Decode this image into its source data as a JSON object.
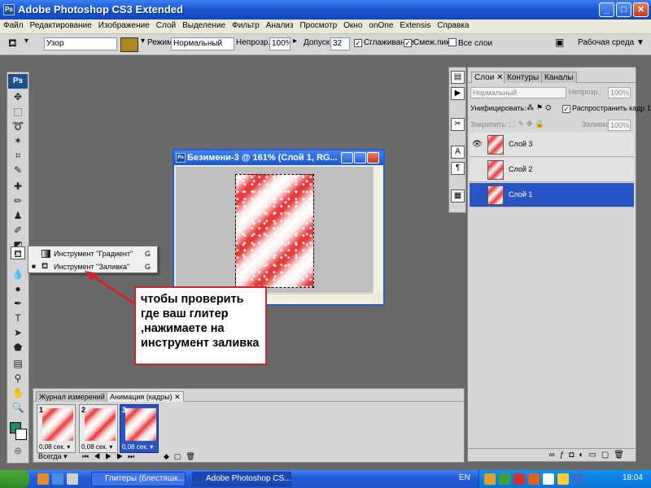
{
  "window": {
    "title": "Adobe Photoshop CS3 Extended",
    "logo": "Ps"
  },
  "menu": [
    "Файл",
    "Редактирование",
    "Изображение",
    "Слой",
    "Выделение",
    "Фильтр",
    "Анализ",
    "Просмотр",
    "Окно",
    "onOne",
    "Extensis",
    "Справка"
  ],
  "options": {
    "pattern_value": "Узор",
    "mode_label": "Режим:",
    "mode_value": "Нормальный",
    "opacity_label": "Непрозр.:",
    "opacity_value": "100%",
    "tolerance_label": "Допуск:",
    "tolerance_value": "32",
    "antialias_label": "Сглаживание",
    "contiguous_label": "Смеж.пикс",
    "all_layers_label": "Все слои",
    "workspace_label": "Рабочая среда"
  },
  "toolbox": {
    "logo": "Ps"
  },
  "flyout": {
    "items": [
      {
        "label": "Инструмент \"Градиент\"",
        "key": "G",
        "active": false
      },
      {
        "label": "Инструмент \"Заливка\"",
        "key": "G",
        "active": true
      }
    ]
  },
  "document": {
    "title": "Безимени-3 @ 161% (Слой 1, RG..."
  },
  "callout": {
    "text": "чтобы проверить где ваш глитер ,нажимаете на инструмент заливка"
  },
  "layers_panel": {
    "tabs": [
      "Слои",
      "Контуры",
      "Каналы"
    ],
    "blend_mode": "Нормальный",
    "opacity_label": "Непрозр.:",
    "opacity_value": "100%",
    "unify_label": "Унифицировать:",
    "propagate_label": "Распространить кадр 1",
    "lock_label": "Закрепить:",
    "fill_label": "Заливка:",
    "fill_value": "100%",
    "layers": [
      {
        "name": "Слой 3",
        "visible": true,
        "selected": false
      },
      {
        "name": "Слой 2",
        "visible": false,
        "selected": false
      },
      {
        "name": "Слой 1",
        "visible": false,
        "selected": true
      }
    ]
  },
  "animation_panel": {
    "tabs": [
      "Журнал измерений",
      "Анимация (кадры)"
    ],
    "frames": [
      {
        "number": "1",
        "delay": "0,08 сек.",
        "selected": false
      },
      {
        "number": "2",
        "delay": "0,08 сек.",
        "selected": false
      },
      {
        "number": "3",
        "delay": "0,08 сек.",
        "selected": true
      }
    ],
    "loop": "Всегда"
  },
  "taskbar": {
    "tasks": [
      {
        "label": "Глитеры (блестяшк...",
        "active": false
      },
      {
        "label": "Adobe Photoshop CS...",
        "active": true
      }
    ],
    "lang": "EN",
    "clock": "18:04"
  },
  "colors": {
    "foreground": "#1c8c5c",
    "background": "#ffffff",
    "accent": "#c8262a",
    "selection": "#2a56c5"
  }
}
